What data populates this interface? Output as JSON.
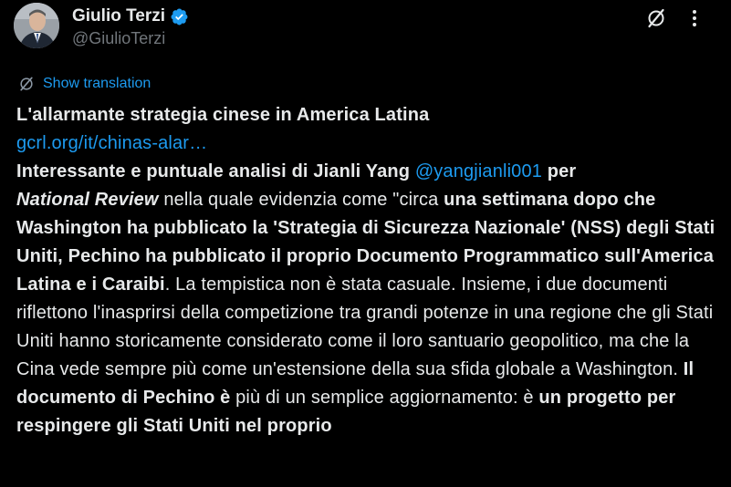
{
  "colors": {
    "background": "#000000",
    "text": "#e7e9ea",
    "muted": "#71767b",
    "accent": "#1d9bf0"
  },
  "author": {
    "name": "Giulio Terzi",
    "handle": "@GiulioTerzi",
    "verified_icon": "verified-badge-icon",
    "avatar_icon": "avatar"
  },
  "header_actions": [
    {
      "icon": "grok-icon"
    },
    {
      "icon": "more-options-icon",
      "label": "⋮"
    }
  ],
  "translation": {
    "icon": "translate-icon",
    "label": "Show translation"
  },
  "tweet": {
    "headline": "L'allarmante strategia cinese in America Latina",
    "url": "gcrl.org/it/chinas-alar…",
    "p1_bold": "Interessante e puntuale analisi di Jianli Yang ",
    "mention": "@yangjianli001",
    "p1_bold_end": " per",
    "publication": "National Review",
    "p2": " nella quale evidenzia come \"circa ",
    "p2_bold": "una settimana dopo che Washington ha pubblicato la 'Strategia di Sicurezza Nazionale' (NSS) degli Stati Uniti, Pechino ha pubblicato il proprio Documento Programmatico sull'America Latina e i Caraibi",
    "p3": ". La tempistica non è stata casuale. Insieme, i due documenti riflettono l'inasprirsi della competizione tra grandi potenze in una regione che gli Stati Uniti hanno storicamente considerato come il loro santuario geopolitico, ma che la Cina vede sempre più come un'estensione della sua sfida globale a Washington. ",
    "p3_bold": "Il documento di Pechino è",
    "p4": " più di un semplice aggiornamento: è ",
    "p4_bold": "un progetto per respingere gli Stati Uniti nel proprio"
  }
}
